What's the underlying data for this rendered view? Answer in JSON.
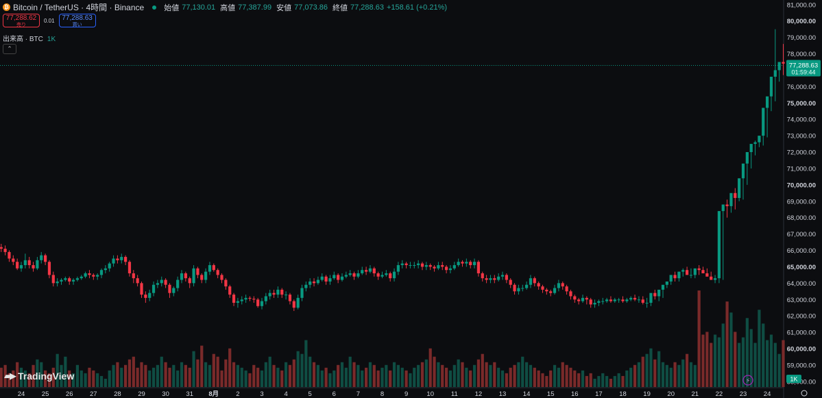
{
  "header": {
    "title": "Bitcoin / TetherUS · 4時間 · Binance",
    "ohlc": [
      {
        "label": "始値",
        "value": "77,130.01"
      },
      {
        "label": "高値",
        "value": "77,387.99"
      },
      {
        "label": "安値",
        "value": "77,073.86"
      },
      {
        "label": "終値",
        "value": "77,288.63"
      }
    ],
    "change": "+158.61 (+0.21%)",
    "sell_price": "77,288.62",
    "sell_label": "売り",
    "spread": "0.01",
    "buy_price": "77,288.63",
    "buy_label": "買い",
    "volume_label": "出来高 · BTC",
    "volume_value": "1K"
  },
  "price_tag": {
    "price": "77,288.63",
    "countdown": "01:59:44"
  },
  "volume_tag": "1K",
  "logo": "TradingView",
  "colors": {
    "up": "#089981",
    "down": "#f23645",
    "up_vol": "#0f4d43",
    "down_vol": "#7a2a2a",
    "bg": "#0c0d10",
    "axis_text": "#d1d4dc"
  },
  "chart_data": {
    "type": "candlestick",
    "y_ticks": [
      "81,000.00",
      "80,000.00",
      "79,000.00",
      "78,000.00",
      "77,000.00",
      "76,000.00",
      "75,000.00",
      "74,000.00",
      "73,000.00",
      "72,000.00",
      "71,000.00",
      "70,000.00",
      "69,000.00",
      "68,000.00",
      "67,000.00",
      "66,000.00",
      "65,000.00",
      "64,000.00",
      "63,000.00",
      "62,000.00",
      "61,000.00",
      "60,000.00",
      "59,000.00",
      "58,000.00"
    ],
    "ylim": [
      57700,
      81200
    ],
    "x_ticks": [
      "24",
      "25",
      "26",
      "27",
      "28",
      "29",
      "30",
      "31",
      "8月",
      "2",
      "3",
      "4",
      "5",
      "6",
      "7",
      "8",
      "9",
      "10",
      "11",
      "12",
      "13",
      "14",
      "15",
      "16",
      "17",
      "18",
      "19",
      "20",
      "21",
      "22",
      "23",
      "24"
    ],
    "x_tick_index": [
      0,
      6,
      12,
      18,
      24,
      30,
      36,
      42,
      48,
      54,
      60,
      66,
      72,
      78,
      84,
      90,
      96,
      102,
      108,
      114,
      120,
      126,
      132,
      138,
      144,
      150,
      156,
      162,
      168,
      174,
      180,
      186
    ],
    "start_index": -5,
    "last_price": 77288.63,
    "close": [
      66100,
      65900,
      65500,
      65300,
      64900,
      65100,
      65400,
      65100,
      64900,
      65400,
      65700,
      65300,
      64500,
      64000,
      64100,
      64200,
      64300,
      64100,
      64200,
      64300,
      64400,
      64600,
      64500,
      64400,
      64500,
      64800,
      64900,
      65200,
      65500,
      65400,
      65600,
      65300,
      64600,
      64300,
      64000,
      63300,
      63100,
      63400,
      63900,
      64000,
      64200,
      63900,
      63400,
      63700,
      64200,
      64600,
      64300,
      64000,
      64900,
      64500,
      64200,
      64700,
      65100,
      64800,
      64500,
      64200,
      63800,
      63300,
      62800,
      62900,
      63000,
      63100,
      63050,
      63000,
      62600,
      62900,
      63200,
      63400,
      63300,
      63600,
      63300,
      63300,
      62900,
      62500,
      63100,
      63700,
      63900,
      64100,
      64000,
      64200,
      64400,
      64100,
      64300,
      64500,
      64200,
      64400,
      64500,
      64600,
      64400,
      64600,
      64800,
      64700,
      64900,
      64600,
      64400,
      64500,
      64600,
      64300,
      64700,
      65100,
      65200,
      65100,
      65100,
      65100,
      65200,
      65000,
      65100,
      65000,
      64900,
      65100,
      65000,
      64800,
      64900,
      65100,
      65300,
      65200,
      65300,
      65100,
      65300,
      64600,
      64300,
      64200,
      64300,
      64200,
      64400,
      64500,
      64200,
      63900,
      63500,
      63700,
      63700,
      63900,
      64300,
      64000,
      63800,
      63600,
      63500,
      63400,
      63700,
      64000,
      63800,
      63500,
      63200,
      63000,
      62900,
      63100,
      63000,
      62700,
      62800,
      62900,
      62900,
      63000,
      62900,
      63000,
      63000,
      62900,
      63000,
      63100,
      63000,
      63000,
      62800,
      62800,
      63400,
      63200,
      63600,
      63900,
      64100,
      64500,
      64300,
      64700,
      64800,
      64500,
      64500,
      64900,
      64800,
      64600,
      64400,
      64200,
      64300,
      68400,
      68800,
      68700,
      69500,
      69200,
      70400,
      71300,
      72000,
      72500,
      72600,
      73000,
      74700,
      75400,
      76600,
      77000,
      77500,
      77400,
      78100,
      78500,
      77000,
      77100,
      77288.63
    ],
    "open": [
      66200,
      66100,
      65900,
      65500,
      65300,
      64900,
      65100,
      65400,
      65100,
      64900,
      65400,
      65700,
      65300,
      64500,
      64000,
      64100,
      64200,
      64300,
      64100,
      64200,
      64300,
      64400,
      64600,
      64500,
      64400,
      64500,
      64800,
      64900,
      65200,
      65500,
      65400,
      65600,
      65300,
      64600,
      64300,
      64000,
      63300,
      63100,
      63400,
      63900,
      64000,
      64200,
      63900,
      63400,
      63700,
      64200,
      64600,
      64300,
      64000,
      64900,
      64500,
      64200,
      64700,
      65100,
      64800,
      64500,
      64200,
      63800,
      63300,
      62800,
      62900,
      63000,
      63100,
      63050,
      63000,
      62600,
      62900,
      63200,
      63400,
      63300,
      63600,
      63300,
      63300,
      62900,
      62500,
      63100,
      63700,
      63900,
      64100,
      64000,
      64200,
      64400,
      64100,
      64300,
      64500,
      64200,
      64400,
      64500,
      64600,
      64400,
      64600,
      64800,
      64700,
      64900,
      64600,
      64400,
      64500,
      64600,
      64300,
      64700,
      65100,
      65200,
      65100,
      65100,
      65100,
      65200,
      65000,
      65100,
      65000,
      64900,
      65100,
      65000,
      64800,
      64900,
      65100,
      65300,
      65200,
      65300,
      65100,
      65300,
      64600,
      64300,
      64200,
      64300,
      64200,
      64400,
      64500,
      64200,
      63900,
      63500,
      63700,
      63700,
      63900,
      64300,
      64000,
      63800,
      63600,
      63500,
      63400,
      63700,
      64000,
      63800,
      63500,
      63200,
      63000,
      62900,
      63100,
      63000,
      62700,
      62800,
      62900,
      62900,
      63000,
      62900,
      63000,
      63000,
      62900,
      63000,
      63100,
      63000,
      63000,
      62800,
      62800,
      63400,
      63200,
      63600,
      63900,
      64100,
      64500,
      64300,
      64700,
      64800,
      64500,
      64500,
      64900,
      64800,
      64600,
      64400,
      64200,
      64300,
      68400,
      68800,
      68700,
      69500,
      69200,
      70400,
      71300,
      72000,
      72500,
      72600,
      73000,
      74700,
      75400,
      76600,
      77000,
      77500,
      77400,
      78100,
      78500,
      77000,
      77130.01
    ],
    "high": [
      66400,
      66300,
      66000,
      65700,
      65500,
      65300,
      65800,
      65600,
      65300,
      65600,
      65900,
      65800,
      65400,
      64700,
      64300,
      64300,
      64400,
      64400,
      64300,
      64400,
      64500,
      64700,
      64800,
      64600,
      64600,
      64900,
      65100,
      65300,
      65700,
      65700,
      65800,
      65700,
      65400,
      64800,
      64500,
      64100,
      63500,
      63600,
      64100,
      64200,
      64400,
      64300,
      64000,
      63800,
      64400,
      64800,
      64700,
      64400,
      65100,
      65000,
      64600,
      64900,
      65300,
      65200,
      64900,
      64600,
      64300,
      63900,
      63400,
      63100,
      63200,
      63300,
      63200,
      63200,
      63100,
      63100,
      63400,
      63600,
      63600,
      63800,
      63700,
      63500,
      63400,
      63000,
      63300,
      63900,
      64100,
      64300,
      64300,
      64400,
      64600,
      64500,
      64500,
      64700,
      64600,
      64600,
      64700,
      64800,
      64700,
      64800,
      65000,
      65000,
      65100,
      65000,
      64700,
      64700,
      64800,
      64700,
      64900,
      65300,
      65400,
      65300,
      65300,
      65300,
      65400,
      65300,
      65300,
      65200,
      65100,
      65300,
      65300,
      65100,
      65100,
      65300,
      65500,
      65400,
      65500,
      65400,
      65500,
      65400,
      64700,
      64500,
      64500,
      64500,
      64600,
      64700,
      64600,
      64300,
      64000,
      63900,
      63900,
      64100,
      64500,
      64400,
      64100,
      63900,
      63700,
      63600,
      63900,
      64200,
      64100,
      63900,
      63600,
      63300,
      63100,
      63300,
      63200,
      63100,
      63000,
      63000,
      63100,
      63100,
      63200,
      63100,
      63100,
      63200,
      63100,
      63200,
      63300,
      63200,
      63200,
      63100,
      63000,
      63600,
      63500,
      63800,
      64100,
      64300,
      64700,
      64700,
      64900,
      65000,
      64900,
      64700,
      65100,
      65000,
      64900,
      64700,
      64500,
      64500,
      68700,
      69100,
      69200,
      69800,
      69700,
      70600,
      71600,
      72200,
      72700,
      72900,
      73400,
      75100,
      75600,
      79500,
      77400,
      78600,
      78000,
      78800,
      78800,
      78600,
      77400,
      77387.99
    ],
    "low": [
      65900,
      65700,
      65300,
      65100,
      64800,
      64700,
      64900,
      64900,
      64700,
      64800,
      65200,
      65100,
      64300,
      63800,
      63800,
      63900,
      64100,
      63900,
      63900,
      64100,
      64200,
      64300,
      64300,
      64200,
      64200,
      64300,
      64600,
      64700,
      65000,
      65200,
      65200,
      65100,
      64400,
      64000,
      63800,
      63100,
      62800,
      62900,
      63200,
      63700,
      63800,
      63700,
      63100,
      63200,
      63500,
      64000,
      64100,
      63700,
      63800,
      64300,
      64000,
      64000,
      64500,
      64700,
      64300,
      64000,
      63600,
      63100,
      62600,
      62500,
      62700,
      62800,
      62900,
      62800,
      62500,
      62400,
      62700,
      63000,
      63100,
      63100,
      63100,
      63000,
      62700,
      62300,
      62400,
      62900,
      63500,
      63700,
      63800,
      63900,
      64100,
      63900,
      63900,
      64200,
      64000,
      64100,
      64300,
      64400,
      64200,
      64300,
      64500,
      64500,
      64600,
      64400,
      64200,
      64300,
      64400,
      64100,
      64100,
      64500,
      64900,
      64900,
      64900,
      64900,
      64900,
      64800,
      64800,
      64800,
      64700,
      64800,
      64800,
      64600,
      64600,
      64800,
      65000,
      65000,
      65000,
      64900,
      64900,
      64400,
      64100,
      64000,
      64000,
      64000,
      64100,
      64200,
      64000,
      63700,
      63300,
      63300,
      63500,
      63600,
      63700,
      63800,
      63600,
      63400,
      63300,
      63200,
      63300,
      63500,
      63600,
      63300,
      63000,
      62800,
      62700,
      62800,
      62700,
      62500,
      62500,
      62600,
      62700,
      62800,
      62800,
      62800,
      62800,
      62800,
      62800,
      62900,
      62900,
      62800,
      62700,
      62500,
      62600,
      63000,
      62900,
      63100,
      63700,
      63900,
      64100,
      64100,
      64400,
      64600,
      64300,
      64300,
      64500,
      64600,
      64400,
      64200,
      64000,
      64000,
      64200,
      68000,
      68300,
      68500,
      69000,
      69100,
      70000,
      71000,
      71800,
      72300,
      72400,
      72900,
      74500,
      75100,
      76300,
      76700,
      77200,
      77300,
      77200,
      76600,
      76700,
      77073.86
    ],
    "volume": [
      700,
      800,
      500,
      600,
      900,
      700,
      600,
      500,
      800,
      1000,
      900,
      600,
      500,
      700,
      1200,
      800,
      1100,
      600,
      500,
      800,
      600,
      500,
      700,
      600,
      500,
      400,
      300,
      600,
      800,
      900,
      700,
      800,
      1000,
      1100,
      700,
      900,
      800,
      600,
      700,
      800,
      1100,
      900,
      700,
      800,
      600,
      900,
      800,
      700,
      1300,
      1000,
      1500,
      900,
      800,
      1200,
      1100,
      600,
      1000,
      1400,
      900,
      800,
      700,
      600,
      500,
      800,
      700,
      600,
      900,
      1100,
      800,
      700,
      600,
      900,
      800,
      1000,
      1300,
      1200,
      1700,
      1100,
      900,
      800,
      600,
      700,
      500,
      600,
      800,
      900,
      700,
      1100,
      900,
      800,
      600,
      700,
      900,
      800,
      600,
      700,
      800,
      600,
      900,
      800,
      700,
      600,
      500,
      700,
      800,
      900,
      1000,
      1400,
      1100,
      900,
      800,
      700,
      600,
      800,
      1000,
      900,
      700,
      600,
      800,
      1000,
      1200,
      900,
      800,
      900,
      700,
      600,
      500,
      700,
      800,
      900,
      1100,
      900,
      800,
      700,
      600,
      500,
      400,
      600,
      800,
      700,
      900,
      800,
      700,
      600,
      500,
      600,
      400,
      500,
      300,
      400,
      500,
      400,
      300,
      400,
      500,
      400,
      600,
      700,
      800,
      900,
      1100,
      1200,
      1400,
      1000,
      1300,
      900,
      800,
      700,
      900,
      800,
      1000,
      1200,
      900,
      800,
      3500,
      1900,
      2000,
      1600,
      1900,
      1800,
      2300,
      3100,
      2700,
      2000,
      1600,
      1800,
      2500,
      2100,
      1600,
      2800,
      2300,
      1700,
      1900,
      1600,
      1200,
      1700,
      1200
    ],
    "volume_max": 3600,
    "current_price_line": 77288.63
  }
}
